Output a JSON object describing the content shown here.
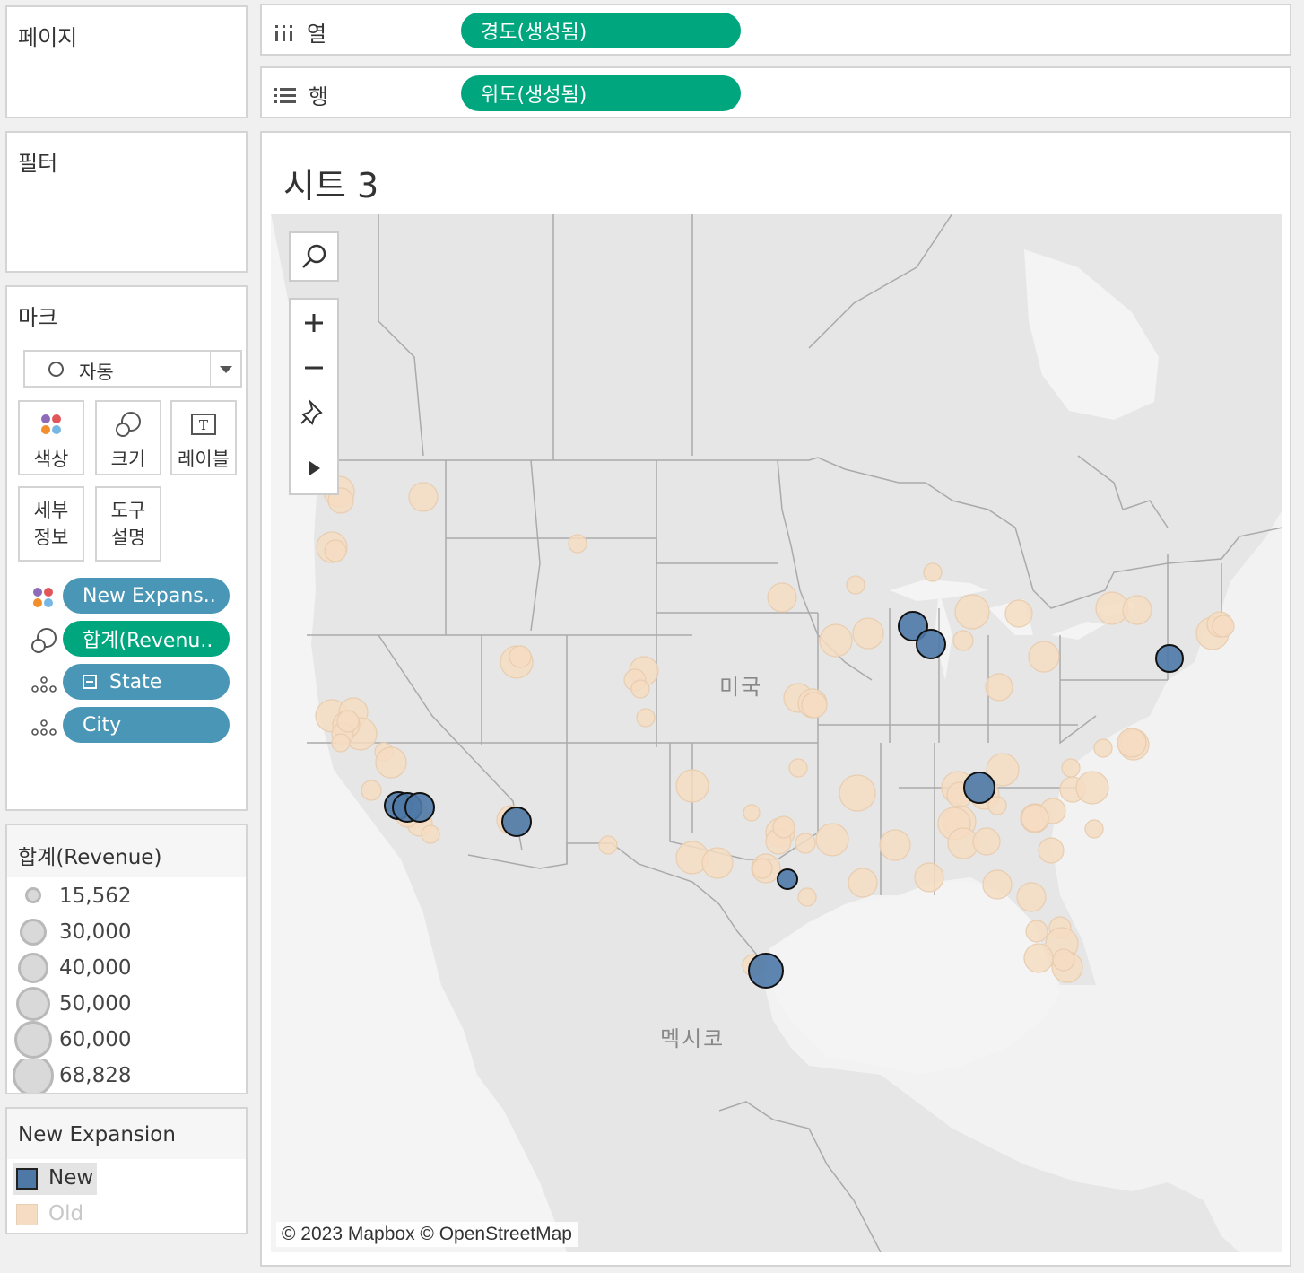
{
  "panels": {
    "pages_title": "페이지",
    "filters_title": "필터",
    "marks_title": "마크"
  },
  "shelves": {
    "columns": {
      "label": "열",
      "pill": "경도(생성됨)"
    },
    "rows": {
      "label": "행",
      "pill": "위도(생성됨)"
    }
  },
  "marks": {
    "type_label": "자동",
    "buttons": {
      "color": "색상",
      "size": "크기",
      "label": "레이블",
      "detail": "세부\n정보",
      "tooltip": "도구\n설명"
    },
    "fields": [
      {
        "kind": "color",
        "label": "New Expans..",
        "color": "#4a96b6"
      },
      {
        "kind": "size",
        "label": "합계(Revenu..",
        "color": "#00a67d"
      },
      {
        "kind": "detail",
        "label": "State",
        "color": "#4a96b6"
      },
      {
        "kind": "detail",
        "label": "City",
        "color": "#4a96b6"
      }
    ]
  },
  "size_legend": {
    "title": "합계(Revenue)",
    "items": [
      "15,562",
      "30,000",
      "40,000",
      "50,000",
      "60,000",
      "68,828"
    ]
  },
  "color_legend": {
    "title": "New Expansion",
    "items": [
      {
        "label": "New",
        "color": "#4e79a7"
      },
      {
        "label": "Old",
        "color": "#f5dcc2"
      }
    ]
  },
  "sheet": {
    "title": "시트 3",
    "labels": {
      "usa": "미국",
      "mexico": "멕시코"
    },
    "copyright": "© 2023 Mapbox © OpenStreetMap"
  },
  "colors": {
    "new_fill": "#4e79a7",
    "old_fill": "#f5dcc2",
    "pill_green": "#00a67d",
    "pill_blue": "#4a96b6"
  }
}
